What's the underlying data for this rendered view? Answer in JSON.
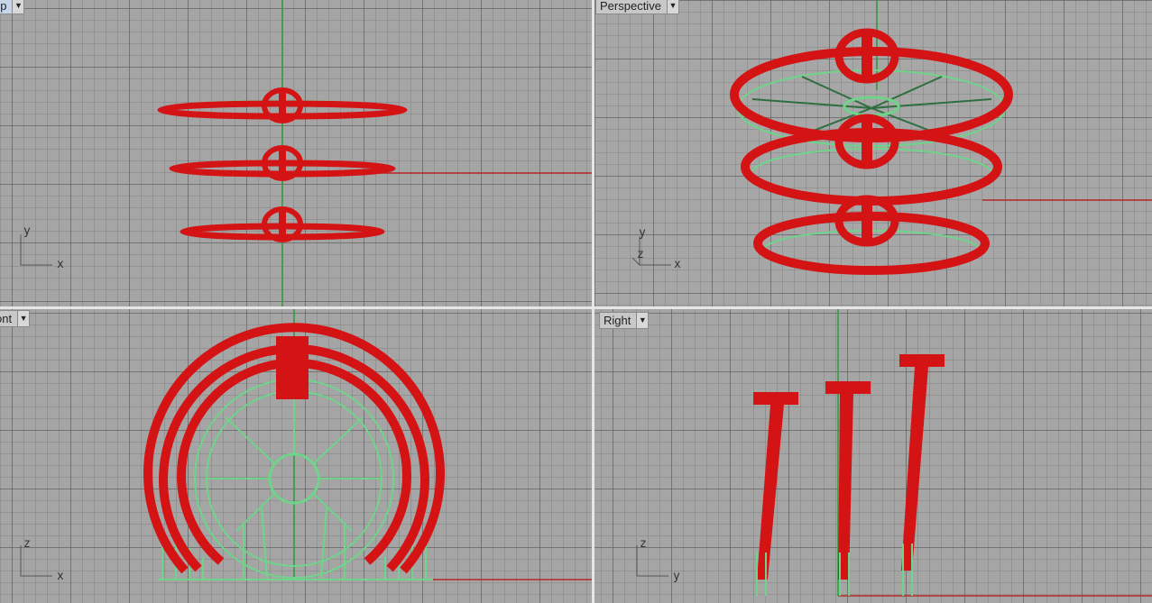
{
  "viewports": {
    "top": {
      "label": "op",
      "menu_glyph": "▼",
      "axis_1": "y",
      "axis_2": "x"
    },
    "persp": {
      "label": "Perspective",
      "menu_glyph": "▼",
      "axis_1": "y",
      "axis_2": "z",
      "axis_3": "x"
    },
    "front": {
      "label": "ont",
      "menu_glyph": "▼",
      "axis_1": "z",
      "axis_2": "x"
    },
    "right": {
      "label": "Right",
      "menu_glyph": "▼",
      "axis_1": "z",
      "axis_2": "y"
    }
  },
  "colors": {
    "viewport_bg": "#a5a5a5",
    "model_red": "#d41414",
    "model_green": "#6fd48a",
    "world_axis_y": "#2e9b3a",
    "world_axis_x": "#b52a2a"
  },
  "model": {
    "ring_count": 3
  }
}
